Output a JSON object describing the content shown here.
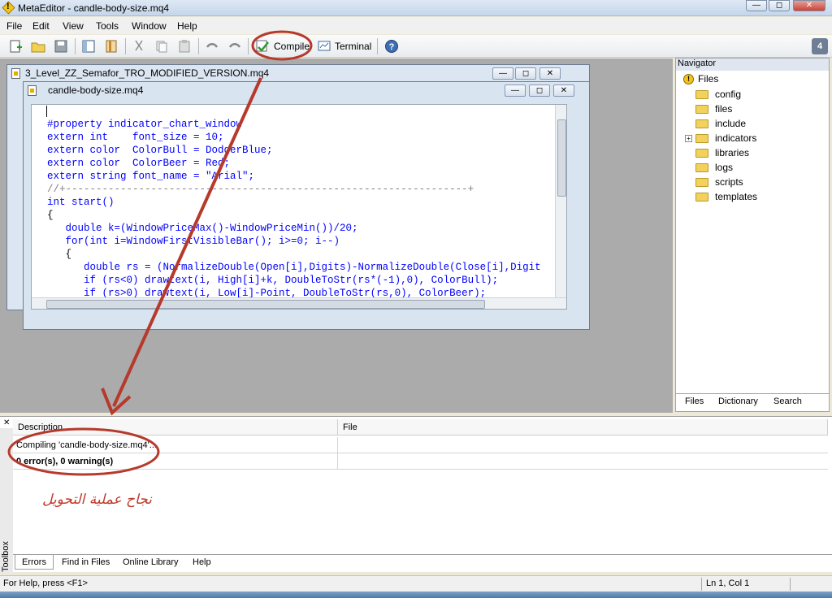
{
  "window": {
    "title": "MetaEditor - candle-body-size.mq4"
  },
  "menu": [
    "File",
    "Edit",
    "View",
    "Tools",
    "Window",
    "Help"
  ],
  "toolbar": {
    "compile_label": "Compile",
    "terminal_label": "Terminal",
    "help_badge": "4"
  },
  "mdi": {
    "back_title": "3_Level_ZZ_Semafor_TRO_MODIFIED_VERSION.mq4",
    "front_title": "candle-body-size.mq4"
  },
  "code": [
    "#property indicator_chart_window",
    "extern int    font_size = 10;",
    "extern color  ColorBull = DodgerBlue;",
    "extern color  ColorBeer = Red;",
    "extern string font_name = \"Arial\";",
    "//+------------------------------------------------------------------+",
    "int start()",
    "{",
    "   double k=(WindowPriceMax()-WindowPriceMin())/20;",
    "   for(int i=WindowFirstVisibleBar(); i>=0; i--)",
    "   {",
    "      double rs = (NormalizeDouble(Open[i],Digits)-NormalizeDouble(Close[i],Digit",
    "      if (rs<0) drawtext(i, High[i]+k, DoubleToStr(rs*(-1),0), ColorBull);",
    "      if (rs>0) drawtext(i, Low[i]-Point, DoubleToStr(rs,0), ColorBeer);",
    "   }"
  ],
  "navigator": {
    "header": "Navigator",
    "root": "Files",
    "folders": [
      "config",
      "files",
      "include",
      "indicators",
      "libraries",
      "logs",
      "scripts",
      "templates"
    ],
    "tabs": [
      "Files",
      "Dictionary",
      "Search"
    ]
  },
  "toolbox": {
    "label": "Toolbox",
    "columns": [
      "Description",
      "File"
    ],
    "messages": [
      "Compiling 'candle-body-size.mq4'...",
      "0 error(s), 0 warning(s)"
    ],
    "annotation": "نجاح عملية التحويل",
    "tabs": [
      "Errors",
      "Find in Files",
      "Online Library",
      "Help"
    ]
  },
  "status": {
    "help_text": "For Help, press <F1>",
    "position": "Ln 1, Col 1"
  },
  "colors": {
    "keyword": "#0000ff",
    "function": "#9a00c8",
    "annotation": "#c0392b"
  }
}
